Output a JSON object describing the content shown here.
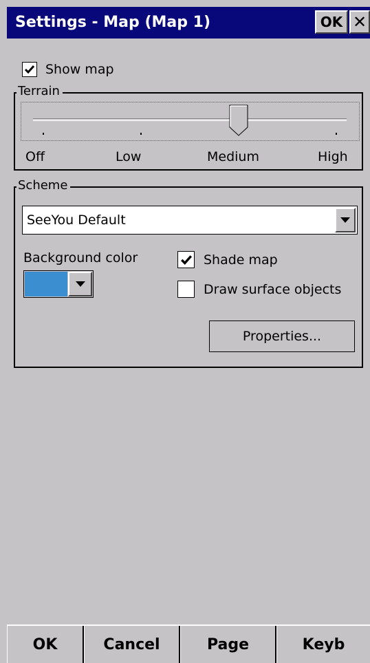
{
  "titlebar": {
    "title": "Settings - Map (Map 1)",
    "ok_label": "OK",
    "close_label": "✕"
  },
  "show_map": {
    "label": "Show map",
    "checked": true
  },
  "terrain": {
    "title": "Terrain",
    "labels": [
      "Off",
      "Low",
      "Medium",
      "High"
    ],
    "selected": "Medium"
  },
  "scheme": {
    "title": "Scheme",
    "selected": "SeeYou Default",
    "background_color_label": "Background color",
    "background_color": "#3b8ecf",
    "shade_map": {
      "label": "Shade map",
      "checked": true
    },
    "draw_surface": {
      "label": "Draw surface objects",
      "checked": false
    },
    "properties_label": "Properties..."
  },
  "softkeys": [
    "OK",
    "Cancel",
    "Page",
    "Keyb"
  ]
}
